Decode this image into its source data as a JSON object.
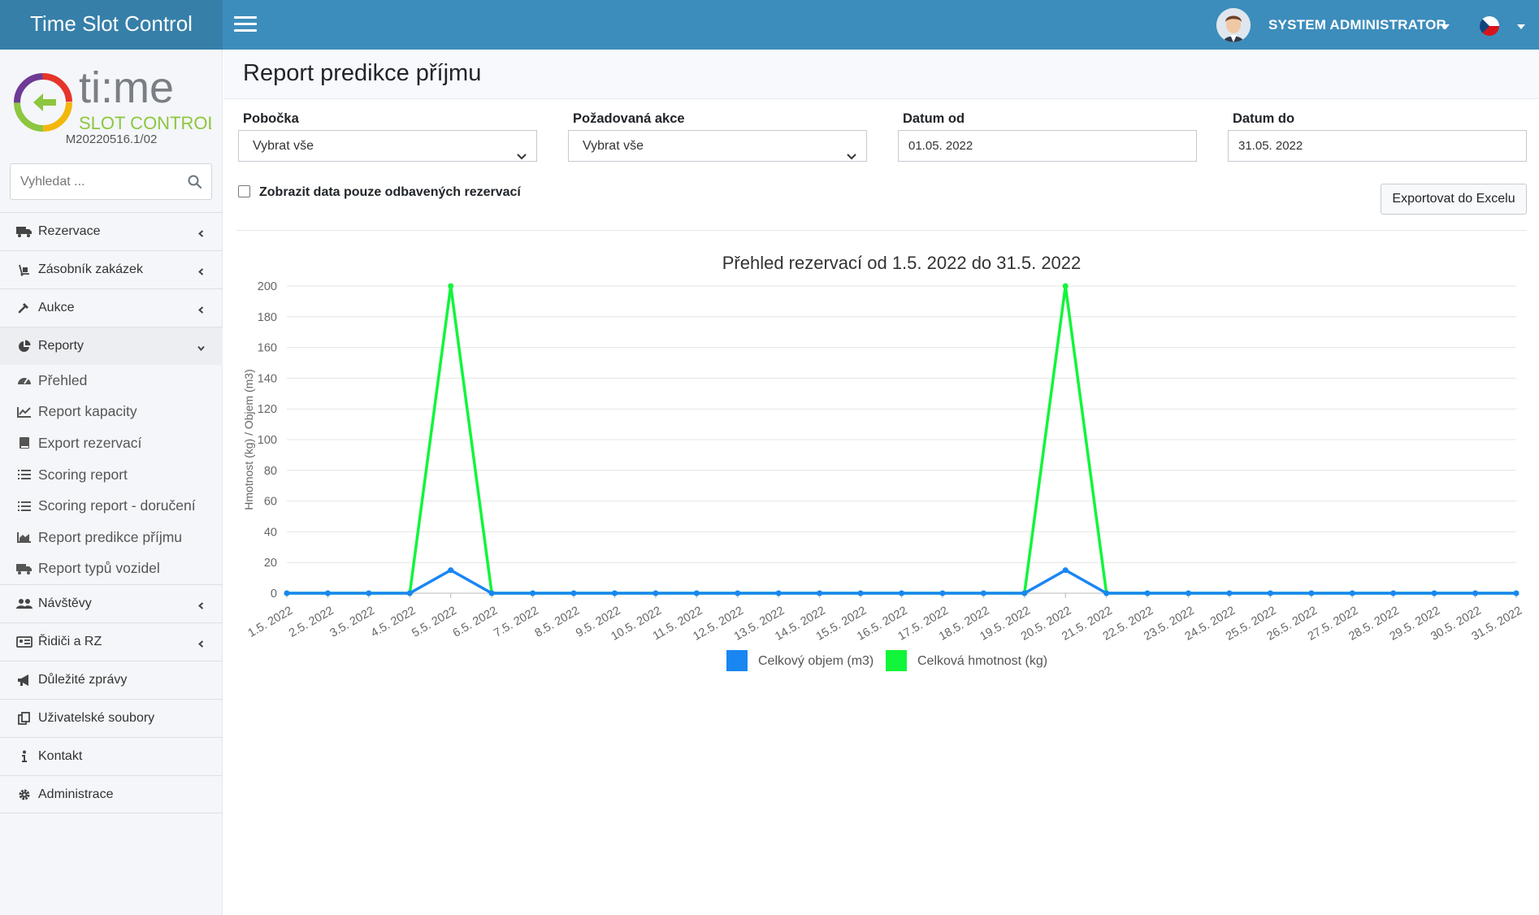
{
  "app": {
    "title": "Time Slot Control",
    "user": "SYSTEM ADMINISTRATOR",
    "version": "M20220516.1/02",
    "logo_brand": "ti:me",
    "logo_sub": "SLOT CONTROL"
  },
  "icons": {
    "menu": "hamburger-icon",
    "search": "search-icon",
    "language": "czech-flag-icon"
  },
  "colors": {
    "topbar": "#3c8dbc",
    "brand": "#367fa9",
    "series_volume": "#1a86f2",
    "series_weight": "#11f53a"
  },
  "sidebar": {
    "search_placeholder": "Vyhledat ...",
    "items": [
      {
        "label": "Rezervace",
        "icon": "truck-icon",
        "chevron": "left"
      },
      {
        "label": "Zásobník zakázek",
        "icon": "dolly-icon",
        "chevron": "left"
      },
      {
        "label": "Aukce",
        "icon": "gavel-icon",
        "chevron": "left"
      },
      {
        "label": "Reporty",
        "icon": "pie-chart-icon",
        "chevron": "down"
      }
    ],
    "subitems": [
      {
        "label": "Přehled",
        "icon": "dashboard-gauge-icon"
      },
      {
        "label": "Report kapacity",
        "icon": "line-chart-icon"
      },
      {
        "label": "Export rezervací",
        "icon": "book-icon"
      },
      {
        "label": "Scoring report",
        "icon": "list-icon"
      },
      {
        "label": "Scoring report - doručení",
        "icon": "list-icon"
      },
      {
        "label": "Report predikce příjmu",
        "icon": "area-chart-icon"
      },
      {
        "label": "Report typů vozidel",
        "icon": "truck-icon"
      }
    ],
    "items_after": [
      {
        "label": "Návštěvy",
        "icon": "users-icon",
        "chevron": "left"
      },
      {
        "label": "Řidiči a RZ",
        "icon": "id-card-icon",
        "chevron": "left"
      },
      {
        "label": "Důležité zprávy",
        "icon": "megaphone-icon"
      },
      {
        "label": "Uživatelské soubory",
        "icon": "copy-icon"
      },
      {
        "label": "Kontakt",
        "icon": "info-icon"
      },
      {
        "label": "Administrace",
        "icon": "gear-icon"
      }
    ]
  },
  "page": {
    "title": "Report predikce příjmu",
    "filters": {
      "branch_label": "Pobočka",
      "branch_value": "Vybrat vše",
      "action_label": "Požadovaná akce",
      "action_value": "Vybrat vše",
      "date_from_label": "Datum od",
      "date_from_value": "01.05. 2022",
      "date_to_label": "Datum do",
      "date_to_value": "31.05. 2022"
    },
    "checkbox_label": "Zobrazit data pouze odbavených rezervací",
    "export_button": "Exportovat do Excelu"
  },
  "chart_data": {
    "type": "line",
    "title": "Přehled rezervací od 1.5. 2022 do 31.5. 2022",
    "ylabel": "Hmotnost (kg) / Objem (m3)",
    "xlabel": "",
    "ylim": [
      0,
      200
    ],
    "yticks": [
      0,
      20,
      40,
      60,
      80,
      100,
      120,
      140,
      160,
      180,
      200
    ],
    "grid": true,
    "legend_position": "bottom",
    "categories": [
      "1.5. 2022",
      "2.5. 2022",
      "3.5. 2022",
      "4.5. 2022",
      "5.5. 2022",
      "6.5. 2022",
      "7.5. 2022",
      "8.5. 2022",
      "9.5. 2022",
      "10.5. 2022",
      "11.5. 2022",
      "12.5. 2022",
      "13.5. 2022",
      "14.5. 2022",
      "15.5. 2022",
      "16.5. 2022",
      "17.5. 2022",
      "18.5. 2022",
      "19.5. 2022",
      "20.5. 2022",
      "21.5. 2022",
      "22.5. 2022",
      "23.5. 2022",
      "24.5. 2022",
      "25.5. 2022",
      "26.5. 2022",
      "27.5. 2022",
      "28.5. 2022",
      "29.5. 2022",
      "30.5. 2022",
      "31.5. 2022"
    ],
    "series": [
      {
        "name": "Celkový objem (m3)",
        "color": "#1a86f2",
        "values": [
          0,
          0,
          0,
          0,
          15,
          0,
          0,
          0,
          0,
          0,
          0,
          0,
          0,
          0,
          0,
          0,
          0,
          0,
          0,
          15,
          0,
          0,
          0,
          0,
          0,
          0,
          0,
          0,
          0,
          0,
          0
        ]
      },
      {
        "name": "Celková hmotnost (kg)",
        "color": "#11f53a",
        "values": [
          0,
          0,
          0,
          0,
          200,
          0,
          0,
          0,
          0,
          0,
          0,
          0,
          0,
          0,
          0,
          0,
          0,
          0,
          0,
          200,
          0,
          0,
          0,
          0,
          0,
          0,
          0,
          0,
          0,
          0,
          0
        ]
      }
    ]
  }
}
